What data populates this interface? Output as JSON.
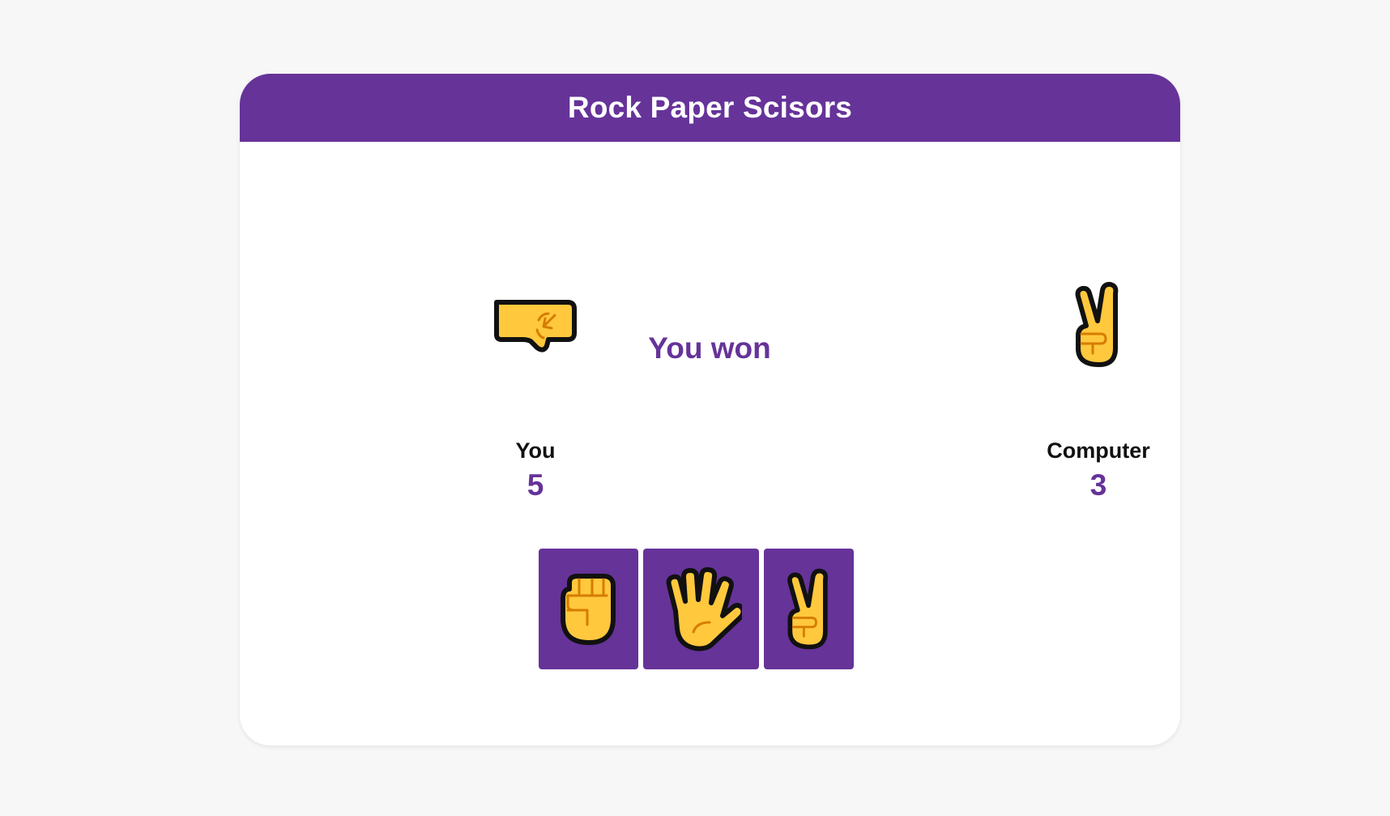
{
  "app": {
    "title": "Rock Paper Scisors"
  },
  "player": {
    "name": "You",
    "score": "5",
    "hand_icon": "oncoming-fist-icon"
  },
  "computer": {
    "name": "Computer",
    "score": "3",
    "hand_icon": "victory-hand-icon"
  },
  "result": {
    "text": "You won"
  },
  "choices": [
    {
      "id": "rock",
      "icon": "raised-fist-icon"
    },
    {
      "id": "paper",
      "icon": "raised-hand-icon"
    },
    {
      "id": "scissors",
      "icon": "victory-hand-icon"
    }
  ],
  "colors": {
    "accent": "#663399",
    "hand_fill": "#FFC83D",
    "hand_detail": "#D67D00",
    "hand_outline": "#111111"
  }
}
